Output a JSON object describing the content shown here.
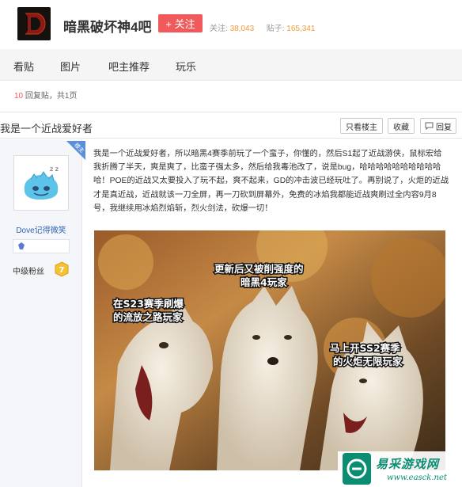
{
  "header": {
    "forum_name": "暗黑破坏神4吧",
    "follow_label": "+ 关注",
    "follow_stat_label": "关注:",
    "follow_count": "38,043",
    "post_stat_label": "贴子:",
    "post_count": "165,341"
  },
  "nav": {
    "items": [
      "看贴",
      "图片",
      "吧主推荐",
      "玩乐"
    ]
  },
  "reply_info": {
    "count": "10",
    "text": "回复贴，共1页"
  },
  "post": {
    "title": "我是一个近战爱好者",
    "buttons": {
      "only_op": "只看楼主",
      "favorite": "收藏",
      "reply": "回复"
    },
    "author": {
      "badge": "楼主",
      "name": "Dove记得微笑",
      "level_name": "中级粉丝",
      "level": "7"
    },
    "body": "我是一个近战爱好者，所以暗黑4赛季前玩了一个蛮子，你懂的，然后S1起了近战游侠，鼠标宏给我折腾了半天，爽是爽了，比蛮子强太多，然后给我毒池改了，说是bug，哈哈哈哈哈哈哈哈哈哈哈！POE的近战又太要投入了玩不起，爽不起来，GD的冲击波已经玩吐了。再别说了，火炬的近战才是真近战，近战就该一刀全屏，再一刀砍到屏幕外，免费的冰焰我都能近战爽刷过全内容9月8号，我继续用冰焰烈焰斩，烈火剑法，砍爆一切！",
    "meme": {
      "left": "在S23赛季刷爆的流放之路玩家",
      "middle": "更新后又被削强度的暗黑4玩家",
      "right": "马上开SS2赛季的火炬无限玩家"
    }
  },
  "watermark": {
    "cn": "易采游戏网",
    "en": "www.easck.net"
  },
  "colors": {
    "accent_red": "#f05a5a",
    "stat_orange": "#f09b3c",
    "link_blue": "#2d64b3",
    "badge_blue": "#5b8fd9",
    "watermark_green": "#0a8d73"
  }
}
